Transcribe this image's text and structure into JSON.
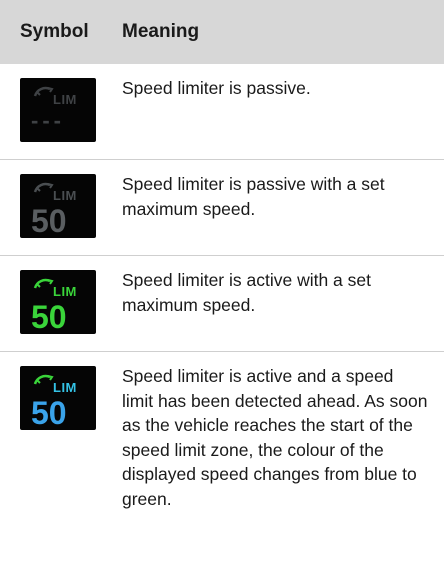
{
  "header": {
    "col1": "Symbol",
    "col2": "Meaning"
  },
  "rows": [
    {
      "icon": "speed-limiter-passive-icon",
      "lim_label": "LIM",
      "speed": "---",
      "text": "Speed limiter is passive."
    },
    {
      "icon": "speed-limiter-passive-set-icon",
      "lim_label": "LIM",
      "speed": "50",
      "text": "Speed limiter is passive with a set maximum speed."
    },
    {
      "icon": "speed-limiter-active-icon",
      "lim_label": "LIM",
      "speed": "50",
      "text": "Speed limiter is active with a set maximum speed."
    },
    {
      "icon": "speed-limiter-active-detected-icon",
      "lim_label": "LIM",
      "speed": "50",
      "text": "Speed limiter is active and a speed limit has been detected ahead. As soon as the vehicle reaches the start of the speed limit zone, the colour of the displayed speed changes from blue to green."
    }
  ],
  "colors": {
    "header_bg": "#d7d7d7",
    "icon_bg": "#050505",
    "passive_grey": "#3f4245",
    "passive_set_grey": "#5a5e61",
    "active_green": "#3ad43a",
    "detected_cyan": "#34c3e6",
    "detected_blue": "#3aa3ea"
  }
}
